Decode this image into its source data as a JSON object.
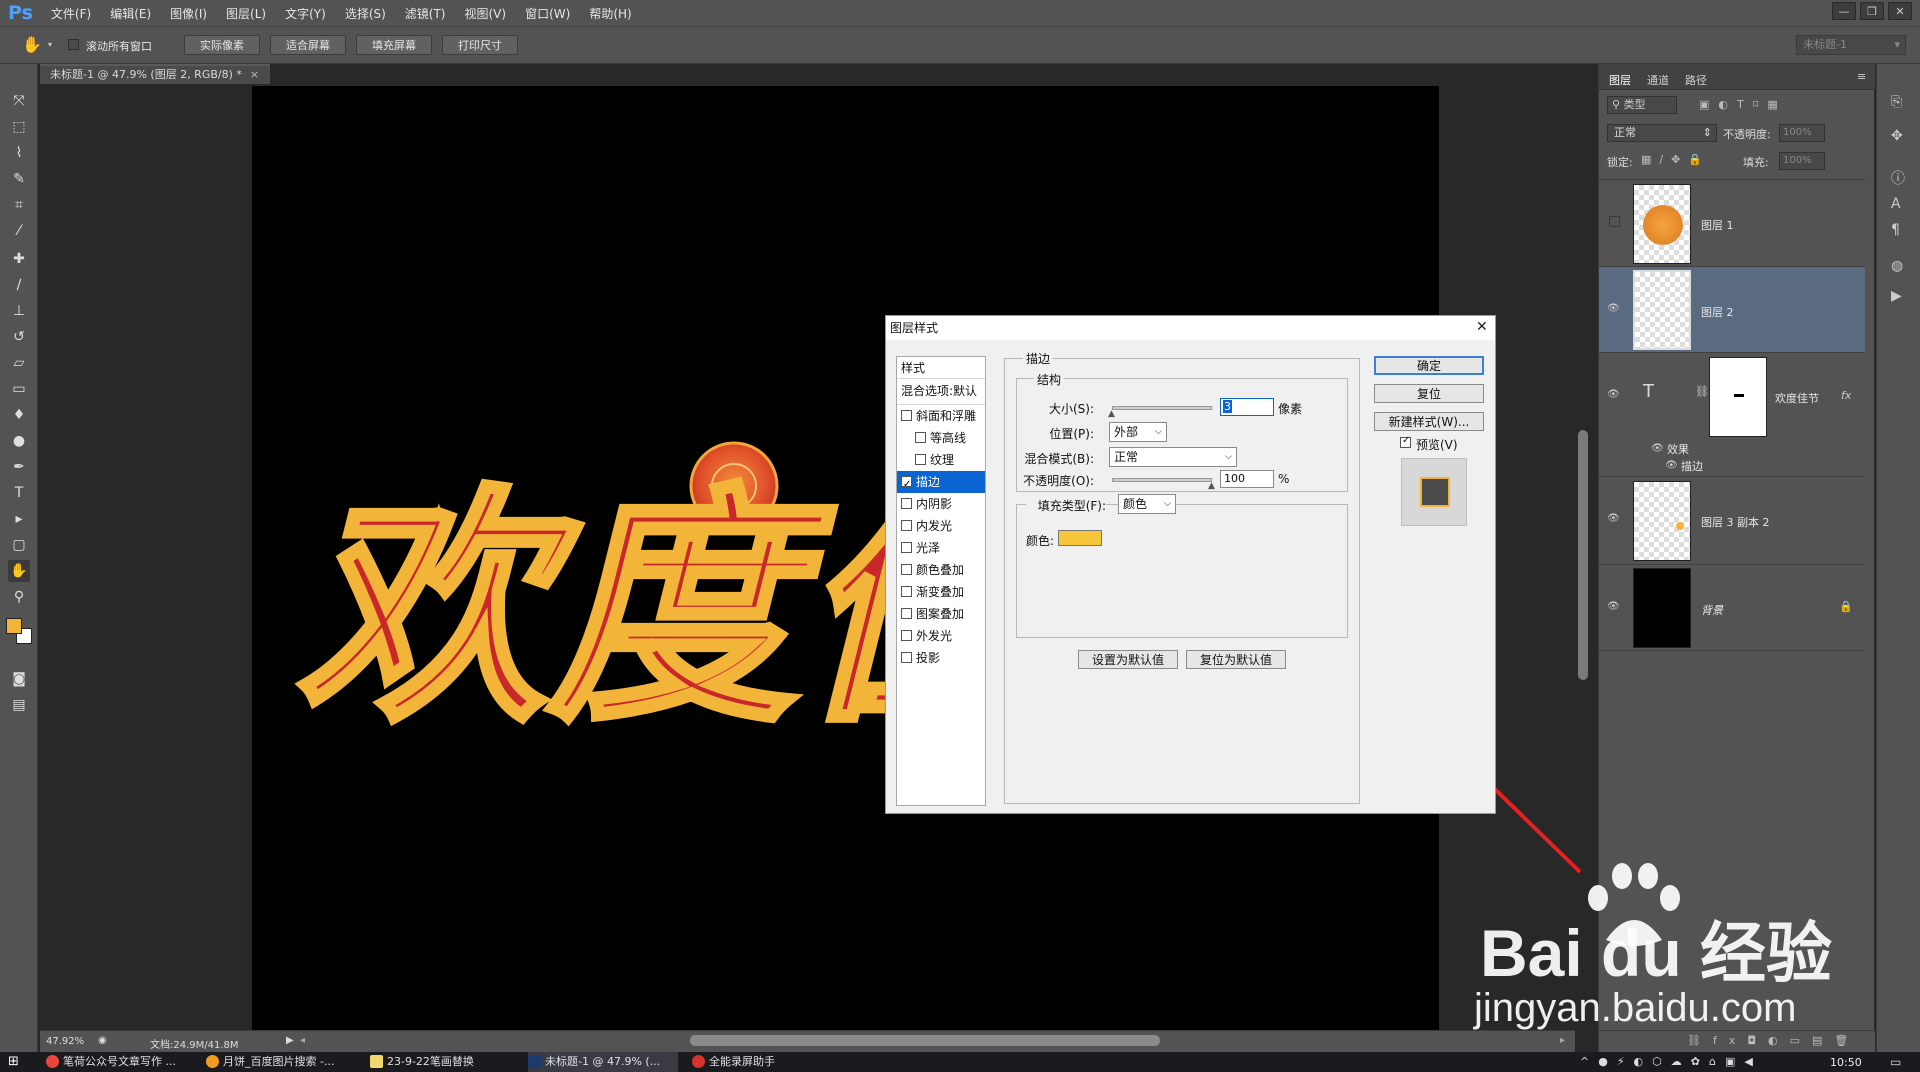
{
  "app": {
    "logo": "Ps"
  },
  "menu": [
    "文件(F)",
    "编辑(E)",
    "图像(I)",
    "图层(L)",
    "文字(Y)",
    "选择(S)",
    "滤镜(T)",
    "视图(V)",
    "窗口(W)",
    "帮助(H)"
  ],
  "options": {
    "scroll_all": "滚动所有窗口",
    "actual_pixels": "实际像素",
    "fit_screen": "适合屏幕",
    "fill_screen": "填充屏幕",
    "print_size": "打印尺寸",
    "workspace": "未标题-1"
  },
  "document": {
    "tab": "未标题-1 @ 47.9% (图层 2, RGB/8) *",
    "zoom": "47.92%",
    "doc_size": "文档:24.9M/41.8M"
  },
  "canvas_text": {
    "line": "欢度佳"
  },
  "colors": {
    "text_red": "#c8282a",
    "stroke_yellow": "#f3b43a",
    "fg_swatch": "#f3b43a",
    "selected_blue": "#0a64d2",
    "layer_sel": "#5a6a80"
  },
  "panels": {
    "tabs": [
      "图层",
      "通道",
      "路径"
    ],
    "filter": "类型",
    "blend_mode": "正常",
    "opacity_label": "不透明度:",
    "opacity_value": "100%",
    "lock_label": "锁定:",
    "fill_label": "填充:",
    "fill_value": "100%",
    "layers": [
      {
        "name": "图层 1"
      },
      {
        "name": "图层 2"
      },
      {
        "name": "欢度佳节",
        "fx": "fx",
        "effects": "效果",
        "effect_item": "描边"
      },
      {
        "name": "图层 3 副本 2"
      },
      {
        "name": "背景"
      }
    ]
  },
  "dialog": {
    "title": "图层样式",
    "styles_header": "样式",
    "blend_options": "混合选项:默认",
    "items": [
      {
        "label": "斜面和浮雕",
        "checked": false
      },
      {
        "label": "等高线",
        "checked": false
      },
      {
        "label": "纹理",
        "checked": false
      },
      {
        "label": "描边",
        "checked": true
      },
      {
        "label": "内阴影",
        "checked": false
      },
      {
        "label": "内发光",
        "checked": false
      },
      {
        "label": "光泽",
        "checked": false
      },
      {
        "label": "颜色叠加",
        "checked": false
      },
      {
        "label": "渐变叠加",
        "checked": false
      },
      {
        "label": "图案叠加",
        "checked": false
      },
      {
        "label": "外发光",
        "checked": false
      },
      {
        "label": "投影",
        "checked": false
      }
    ],
    "section": "描边",
    "structure": "结构",
    "size_label": "大小(S):",
    "size_value": "3",
    "size_unit": "像素",
    "position_label": "位置(P):",
    "position_value": "外部",
    "blend_label": "混合模式(B):",
    "blend_value": "正常",
    "opacity_label": "不透明度(O):",
    "opacity_value": "100",
    "opacity_unit": "%",
    "fill_type_label": "填充类型(F):",
    "fill_type_value": "颜色",
    "color_label": "颜色:",
    "stroke_color": "#f7c53a",
    "set_default": "设置为默认值",
    "reset_default": "复位为默认值",
    "ok": "确定",
    "reset": "复位",
    "new_style": "新建样式(W)...",
    "preview": "预览(V)"
  },
  "watermark": {
    "brand": "Bai du 经验",
    "url": "jingyan.baidu.com"
  },
  "taskbar": {
    "items": [
      "笔荷公众号文章写作 ...",
      "月饼_百度图片搜索 -...",
      "23-9-22笔画替换",
      "未标题-1 @ 47.9% (...",
      "全能录屏助手"
    ],
    "clock": "10:50"
  }
}
